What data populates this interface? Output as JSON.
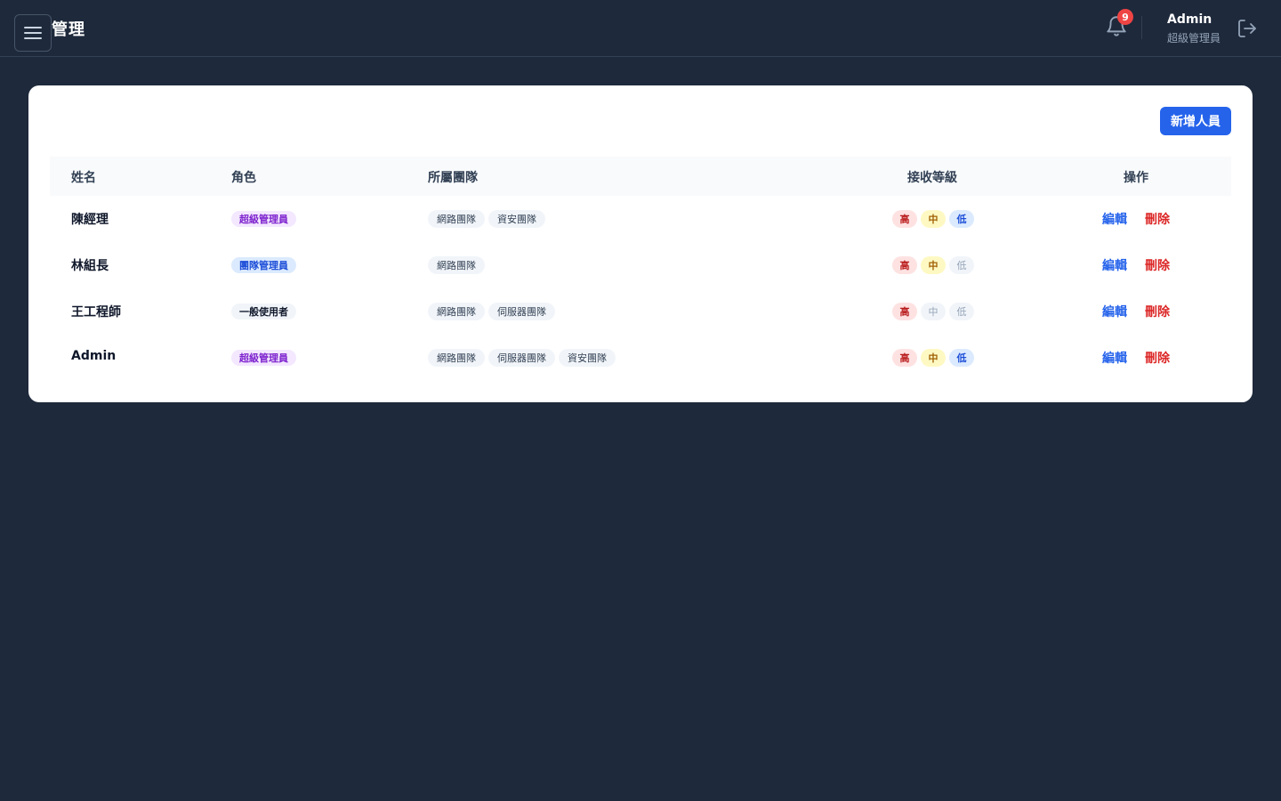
{
  "header": {
    "title": "管理",
    "notification_count": "9",
    "user_name": "Admin",
    "user_role": "超級管理員"
  },
  "toolbar": {
    "add_label": "新增人員"
  },
  "table": {
    "columns": [
      "姓名",
      "角色",
      "所屬團隊",
      "接收等級",
      "操作"
    ],
    "level_labels": {
      "high": "高",
      "mid": "中",
      "low": "低"
    },
    "action_labels": {
      "edit": "編輯",
      "delete": "刪除"
    },
    "rows": [
      {
        "name": "陳經理",
        "role": "超級管理員",
        "role_type": "super",
        "teams": [
          "網路團隊",
          "資安團隊"
        ],
        "levels": {
          "high": true,
          "mid": true,
          "low": true
        }
      },
      {
        "name": "林組長",
        "role": "團隊管理員",
        "role_type": "team",
        "teams": [
          "網路團隊"
        ],
        "levels": {
          "high": true,
          "mid": true,
          "low": false
        }
      },
      {
        "name": "王工程師",
        "role": "一般使用者",
        "role_type": "user",
        "teams": [
          "網路團隊",
          "伺服器團隊"
        ],
        "levels": {
          "high": true,
          "mid": false,
          "low": false
        }
      },
      {
        "name": "Admin",
        "role": "超級管理員",
        "role_type": "super",
        "teams": [
          "網路團隊",
          "伺服器團隊",
          "資安團隊"
        ],
        "levels": {
          "high": true,
          "mid": true,
          "low": true
        }
      }
    ]
  },
  "colors": {
    "background": "#1e293b",
    "primary": "#2563eb",
    "danger": "#dc2626",
    "badge": "#ef4444"
  }
}
